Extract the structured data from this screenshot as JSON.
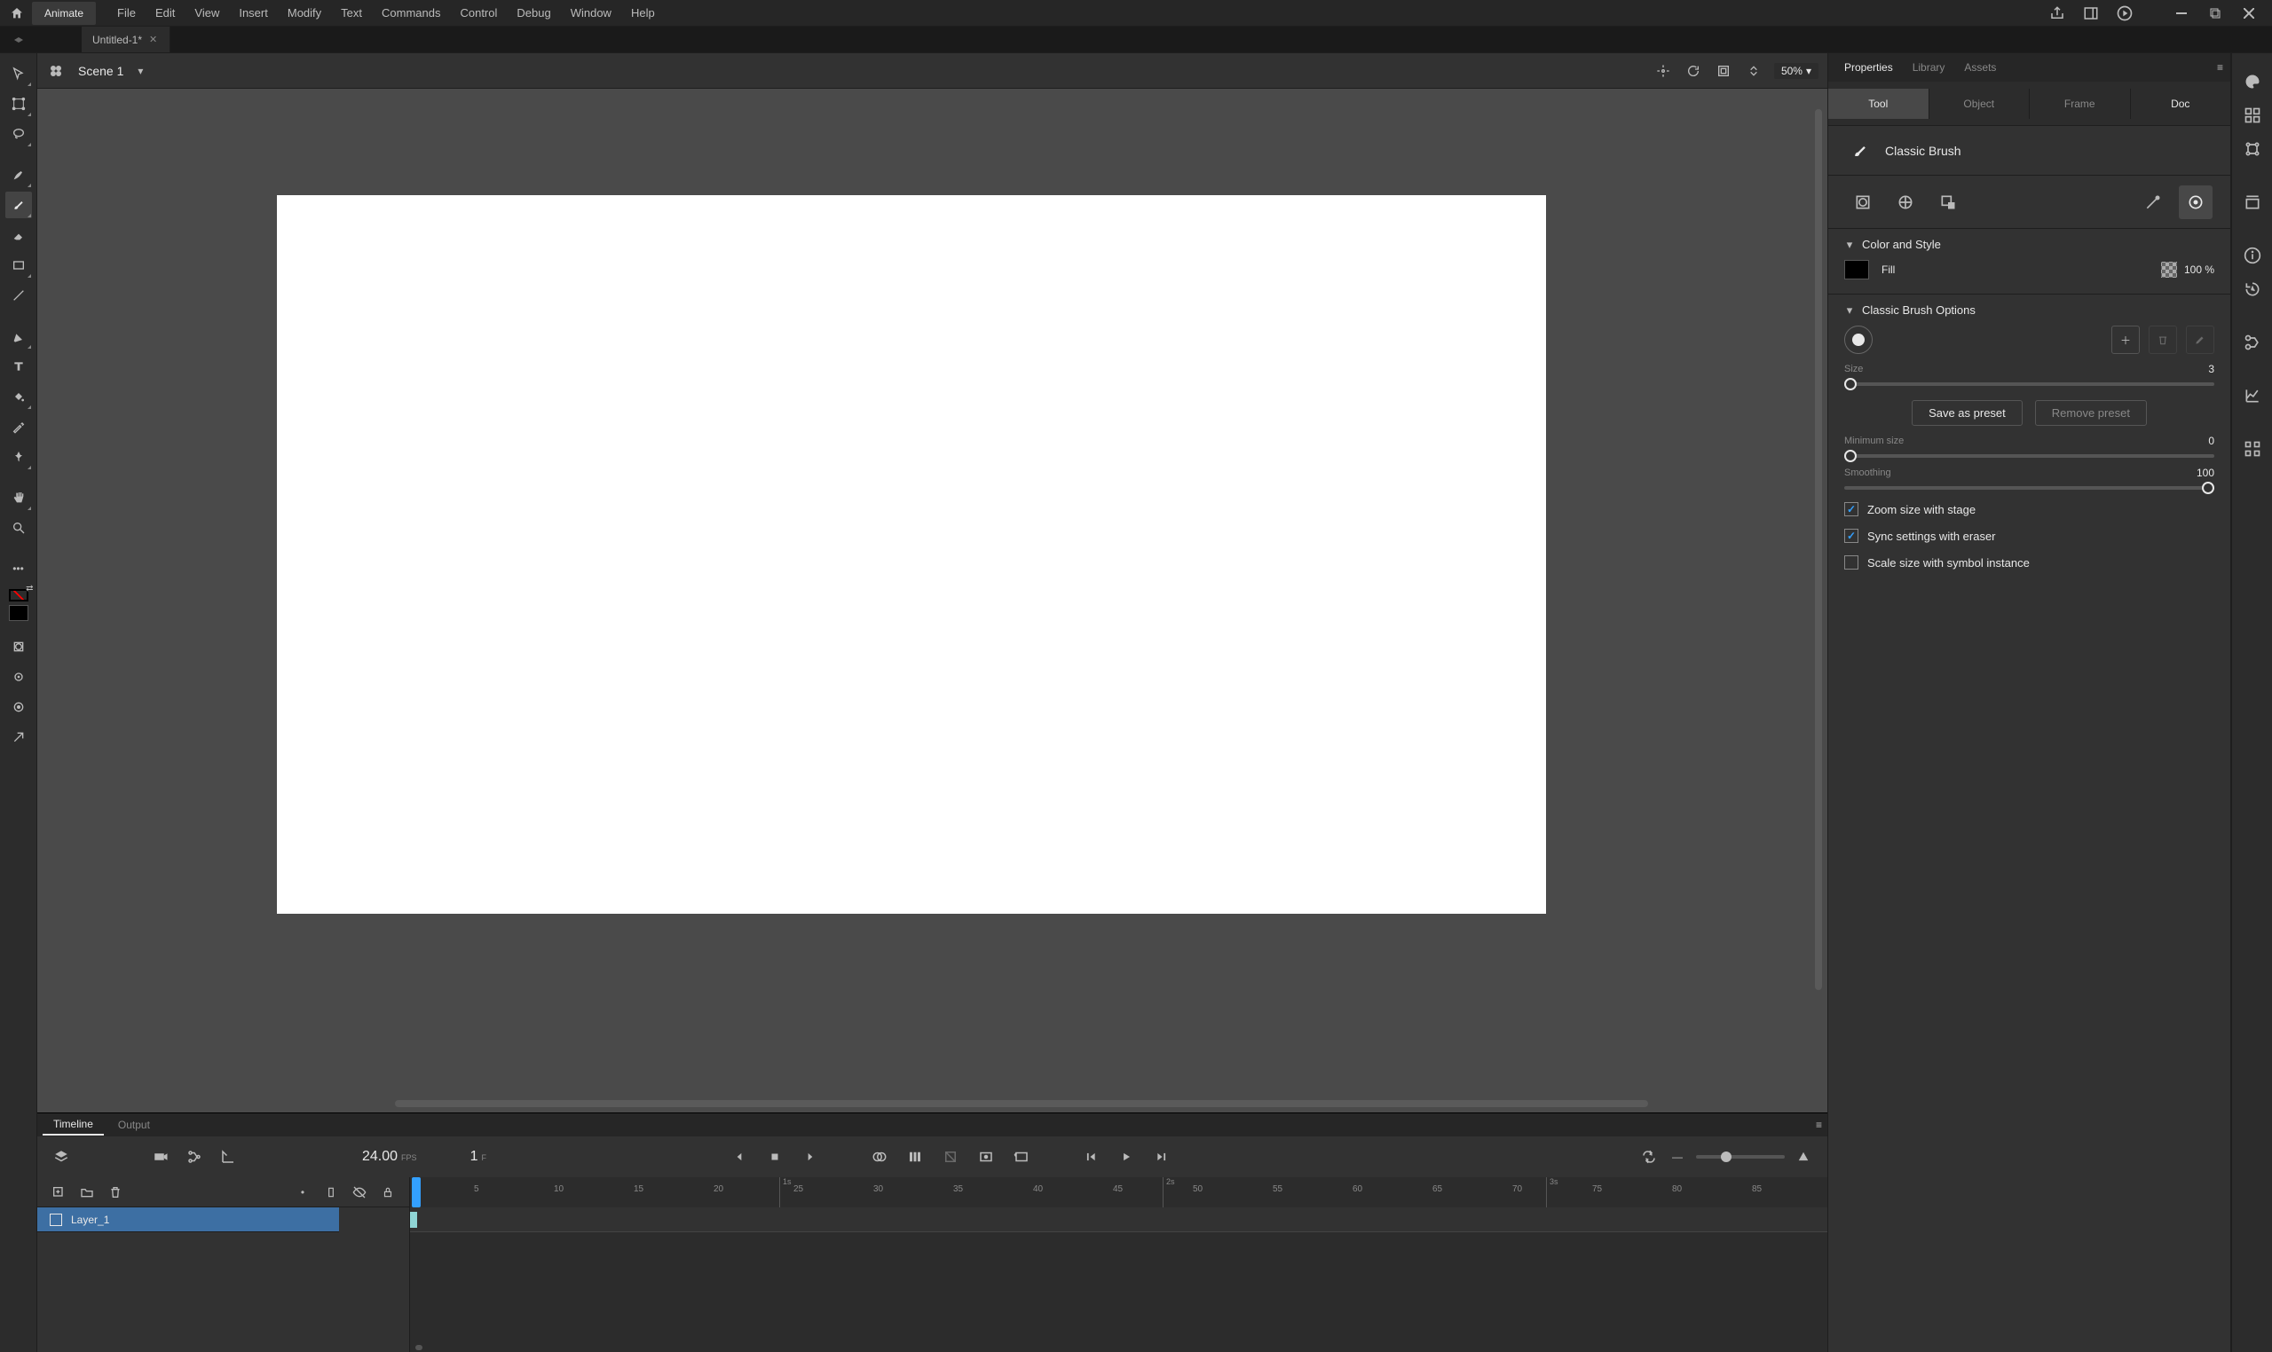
{
  "app": {
    "name": "Animate"
  },
  "menu": {
    "items": [
      "File",
      "Edit",
      "View",
      "Insert",
      "Modify",
      "Text",
      "Commands",
      "Control",
      "Debug",
      "Window",
      "Help"
    ]
  },
  "document": {
    "tabs": [
      {
        "title": "Untitled-1*"
      }
    ]
  },
  "scene": {
    "name": "Scene 1",
    "zoom": "50%"
  },
  "timeline": {
    "tabs": {
      "timeline": "Timeline",
      "output": "Output"
    },
    "fps": "24.00",
    "fps_label": "FPS",
    "frame": "1",
    "frame_label": "F",
    "ruler_marks": [
      5,
      10,
      15,
      20,
      25,
      30,
      35,
      40,
      45,
      50,
      55,
      60,
      65,
      70,
      75,
      80,
      85
    ],
    "second_marks": [
      "1s",
      "2s",
      "3s"
    ],
    "layers": [
      {
        "name": "Layer_1"
      }
    ]
  },
  "panel": {
    "tabs": {
      "properties": "Properties",
      "library": "Library",
      "assets": "Assets"
    },
    "subtabs": {
      "tool": "Tool",
      "object": "Object",
      "frame": "Frame",
      "doc": "Doc"
    },
    "tool_name": "Classic Brush",
    "sections": {
      "color": {
        "title": "Color and Style",
        "fill_label": "Fill",
        "opacity": "100 %"
      },
      "brush": {
        "title": "Classic Brush Options",
        "size_label": "Size",
        "size_value": "3",
        "save_preset": "Save as preset",
        "remove_preset": "Remove preset",
        "min_size_label": "Minimum size",
        "min_size_value": "0",
        "smoothing_label": "Smoothing",
        "smoothing_value": "100",
        "zoom_with_stage": "Zoom size with stage",
        "sync_eraser": "Sync settings with eraser",
        "scale_symbol": "Scale size with symbol instance"
      }
    }
  }
}
